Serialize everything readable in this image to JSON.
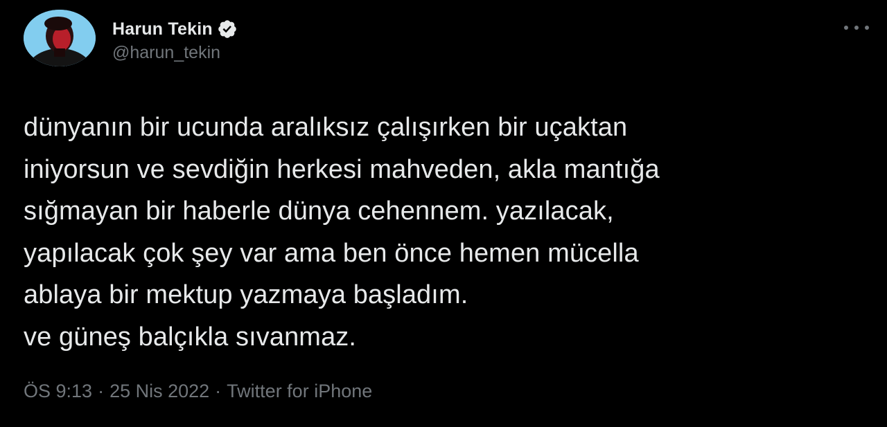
{
  "tweet": {
    "author": {
      "display_name": "Harun Tekin",
      "handle": "@harun_tekin",
      "verified": true,
      "avatar_icon": "profile-photo"
    },
    "more_icon": "more-horizontal-icon",
    "text_lines": [
      "dünyanın bir ucunda aralıksız çalışırken bir uçaktan",
      "iniyorsun ve sevdiğin herkesi mahveden, akla mantığa",
      "sığmayan bir haberle dünya cehennem. yazılacak,",
      "yapılacak çok şey var ama ben önce hemen mücella",
      "ablaya bir mektup yazmaya başladım.",
      "ve güneş balçıkla sıvanmaz."
    ],
    "meta": {
      "time": "ÖS 9:13",
      "separator": "·",
      "date": "25 Nis 2022",
      "source": "Twitter for iPhone"
    }
  },
  "colors": {
    "background": "#000000",
    "primary_text": "#e7e9ea",
    "secondary_text": "#71767b",
    "verified_badge": "#e7e9ea"
  }
}
